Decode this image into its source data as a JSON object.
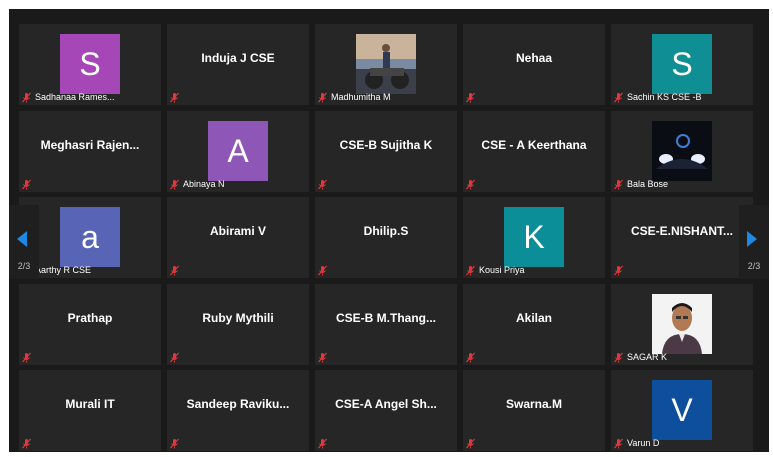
{
  "participants": [
    {
      "name": "Sadhanaa Rames...",
      "display": "avatar",
      "avatar_letter": "S",
      "avatar_color": "#a647b8",
      "muted": true
    },
    {
      "name": "Induja J CSE",
      "display": "name",
      "muted": true
    },
    {
      "name": "Madhumitha M",
      "display": "photo",
      "photo": "photo-person-motorbike",
      "muted": true
    },
    {
      "name": "Nehaa",
      "display": "name",
      "muted": true
    },
    {
      "name": "Sachin KS CSE -B",
      "display": "avatar",
      "avatar_letter": "S",
      "avatar_color": "#0f8f94",
      "muted": true
    },
    {
      "name": "Meghasri  Rajen...",
      "display": "name",
      "muted": true
    },
    {
      "name": "Abinaya N",
      "display": "avatar",
      "avatar_letter": "A",
      "avatar_color": "#8e57b7",
      "muted": true
    },
    {
      "name": "CSE-B Sujitha K",
      "display": "name",
      "muted": true
    },
    {
      "name": "CSE - A Keerthana",
      "display": "name",
      "muted": true
    },
    {
      "name": "Bala Bose",
      "display": "photo",
      "photo": "photo-car-headlights",
      "muted": true
    },
    {
      "name": "Aarthy R CSE",
      "display": "avatar",
      "avatar_letter": "a",
      "avatar_color": "#5864b5",
      "muted": true
    },
    {
      "name": "Abirami V",
      "display": "name",
      "muted": true
    },
    {
      "name": "Dhilip.S",
      "display": "name",
      "muted": true
    },
    {
      "name": "Kousi Priya",
      "display": "avatar",
      "avatar_letter": "K",
      "avatar_color": "#0b8e97",
      "muted": true
    },
    {
      "name": "CSE-E.NISHANT...",
      "display": "name",
      "muted": true
    },
    {
      "name": "Prathap",
      "display": "name",
      "muted": true
    },
    {
      "name": "Ruby Mythili",
      "display": "name",
      "muted": true
    },
    {
      "name": "CSE-B  M.Thang...",
      "display": "name",
      "muted": true
    },
    {
      "name": "Akilan",
      "display": "name",
      "muted": true
    },
    {
      "name": "SAGAR K",
      "display": "photo",
      "photo": "photo-man-portrait",
      "muted": true
    },
    {
      "name": "Murali IT",
      "display": "name",
      "muted": true
    },
    {
      "name": "Sandeep  Raviku...",
      "display": "name",
      "muted": true
    },
    {
      "name": "CSE-A  Angel  Sh...",
      "display": "name",
      "muted": true
    },
    {
      "name": "Swarna.M",
      "display": "name",
      "muted": true
    },
    {
      "name": "Varun D",
      "display": "avatar",
      "avatar_letter": "V",
      "avatar_color": "#0d4f9c",
      "muted": true
    }
  ],
  "pagination": {
    "prev_label": "2/3",
    "next_label": "2/3",
    "prev_icon": "chevron-left-icon",
    "next_icon": "chevron-right-icon",
    "arrow_color": "#1e88e5"
  },
  "colors": {
    "muted_icon": "#e0383b",
    "tile_bg": "#262626"
  }
}
